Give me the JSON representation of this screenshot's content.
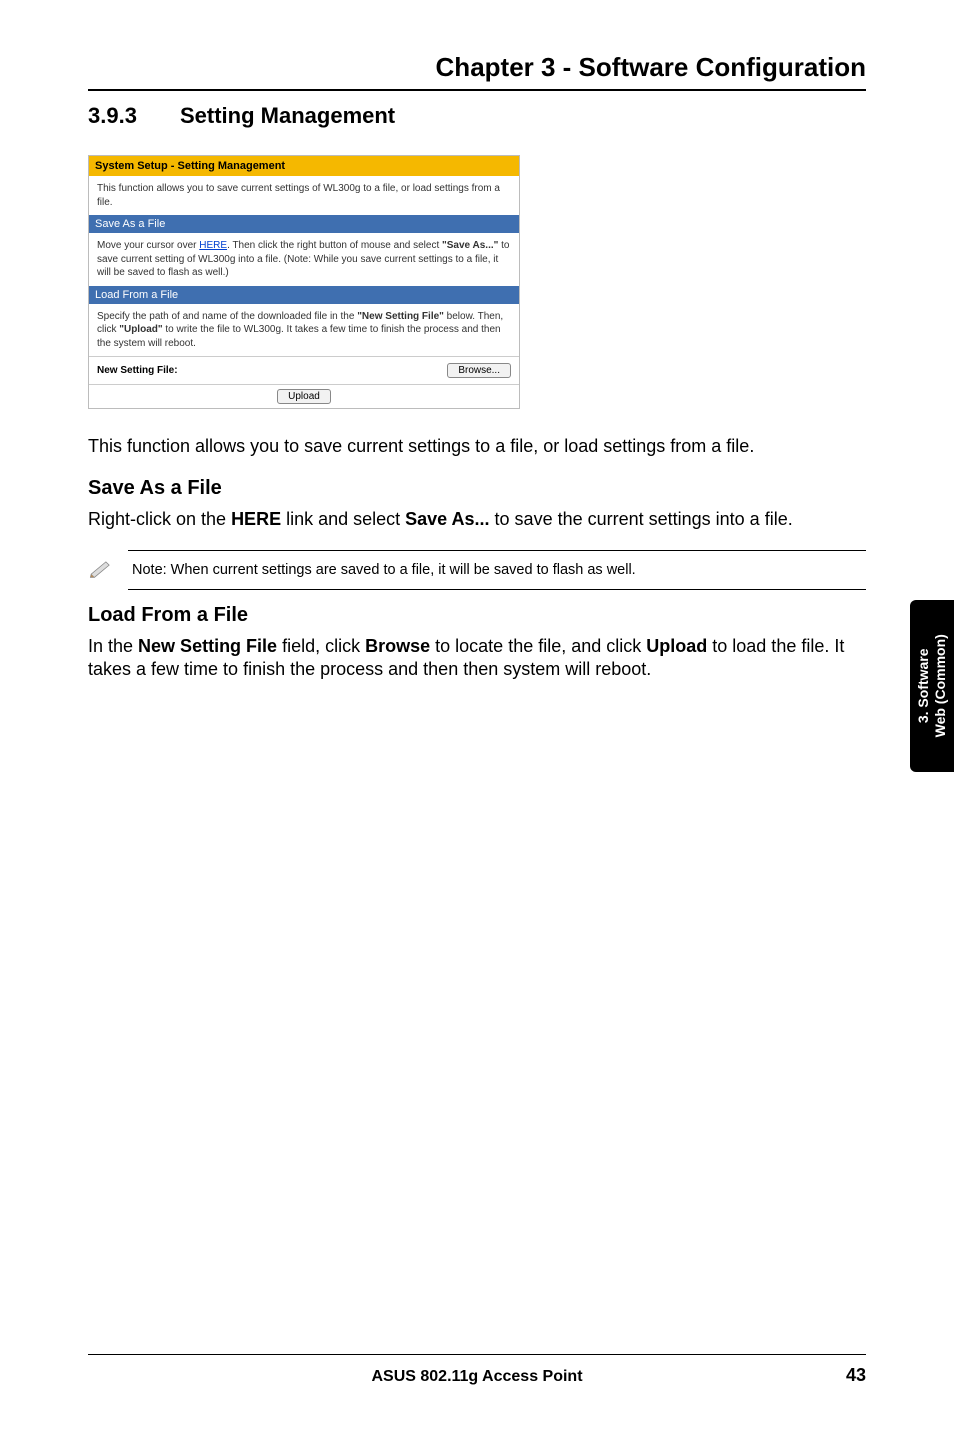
{
  "chapter_title": "Chapter 3 - Software Configuration",
  "section": {
    "number": "3.9.3",
    "title": "Setting Management"
  },
  "shot": {
    "title": "System Setup - Setting Management",
    "intro": "This function allows you to save current settings of WL300g to a file, or load settings from a file.",
    "save_bar": "Save As a File",
    "save_body_pre": "Move your cursor over ",
    "save_body_link": "HERE",
    "save_body_post_a": ". Then click the right button of mouse and select ",
    "save_body_bold_a": "\"Save As...\"",
    "save_body_post_b": " to save current setting of WL300g into a file. (Note: While you save current settings to a file, it will be saved to flash as well.)",
    "load_bar": "Load From a File",
    "load_body_pre": "Specify the path of and name of the downloaded file in the ",
    "load_body_bold_a": "\"New Setting File\"",
    "load_body_mid": " below. Then, click ",
    "load_body_bold_b": "\"Upload\"",
    "load_body_post": " to write the file to WL300g. It takes a few time to finish the process and then the system will reboot.",
    "new_setting_file_label": "New Setting File:",
    "browse_btn": "Browse...",
    "upload_btn": "Upload"
  },
  "para1": "This function allows you to save current settings to a file, or load settings from a file.",
  "save_heading": "Save As a File",
  "save_para_pre": "Right-click on the ",
  "save_para_b1": "HERE",
  "save_para_mid": " link and select ",
  "save_para_b2": "Save As...",
  "save_para_post": " to save the current settings into a file.",
  "note_text": "Note: When current settings are saved to a file, it will be saved to flash as well.",
  "load_heading": "Load From a File",
  "load_para_pre": "In the ",
  "load_para_b1": "New Setting File",
  "load_para_mid1": " field, click ",
  "load_para_b2": "Browse",
  "load_para_mid2": " to locate the file, and click ",
  "load_para_b3": "Upload",
  "load_para_post": " to load the file. It takes a few time to finish the process and then then system will reboot.",
  "sidetab_line1": "3. Software",
  "sidetab_line2": "Web (Common)",
  "footer_center": "ASUS 802.11g Access Point",
  "footer_page": "43"
}
